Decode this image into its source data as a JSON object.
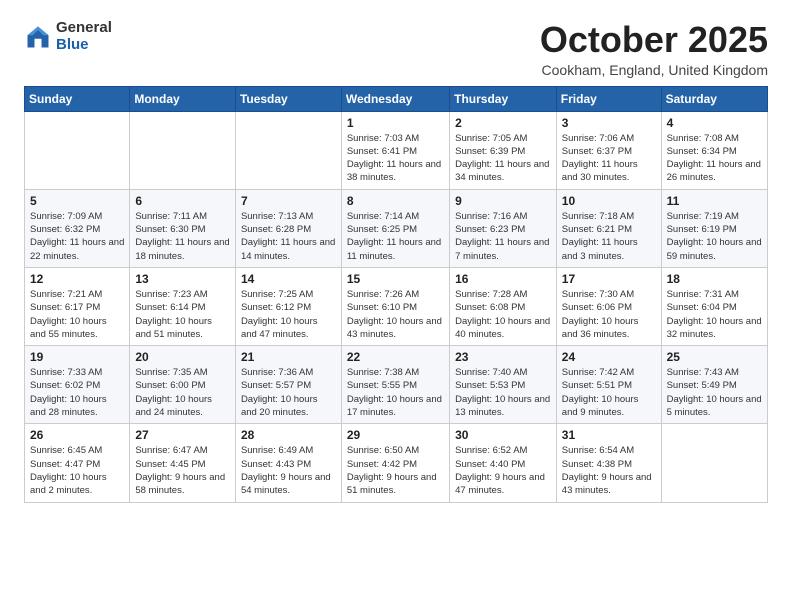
{
  "logo": {
    "general": "General",
    "blue": "Blue"
  },
  "title": "October 2025",
  "location": "Cookham, England, United Kingdom",
  "days_of_week": [
    "Sunday",
    "Monday",
    "Tuesday",
    "Wednesday",
    "Thursday",
    "Friday",
    "Saturday"
  ],
  "weeks": [
    [
      {
        "day": "",
        "info": ""
      },
      {
        "day": "",
        "info": ""
      },
      {
        "day": "",
        "info": ""
      },
      {
        "day": "1",
        "info": "Sunrise: 7:03 AM\nSunset: 6:41 PM\nDaylight: 11 hours\nand 38 minutes."
      },
      {
        "day": "2",
        "info": "Sunrise: 7:05 AM\nSunset: 6:39 PM\nDaylight: 11 hours\nand 34 minutes."
      },
      {
        "day": "3",
        "info": "Sunrise: 7:06 AM\nSunset: 6:37 PM\nDaylight: 11 hours\nand 30 minutes."
      },
      {
        "day": "4",
        "info": "Sunrise: 7:08 AM\nSunset: 6:34 PM\nDaylight: 11 hours\nand 26 minutes."
      }
    ],
    [
      {
        "day": "5",
        "info": "Sunrise: 7:09 AM\nSunset: 6:32 PM\nDaylight: 11 hours\nand 22 minutes."
      },
      {
        "day": "6",
        "info": "Sunrise: 7:11 AM\nSunset: 6:30 PM\nDaylight: 11 hours\nand 18 minutes."
      },
      {
        "day": "7",
        "info": "Sunrise: 7:13 AM\nSunset: 6:28 PM\nDaylight: 11 hours\nand 14 minutes."
      },
      {
        "day": "8",
        "info": "Sunrise: 7:14 AM\nSunset: 6:25 PM\nDaylight: 11 hours\nand 11 minutes."
      },
      {
        "day": "9",
        "info": "Sunrise: 7:16 AM\nSunset: 6:23 PM\nDaylight: 11 hours\nand 7 minutes."
      },
      {
        "day": "10",
        "info": "Sunrise: 7:18 AM\nSunset: 6:21 PM\nDaylight: 11 hours\nand 3 minutes."
      },
      {
        "day": "11",
        "info": "Sunrise: 7:19 AM\nSunset: 6:19 PM\nDaylight: 10 hours\nand 59 minutes."
      }
    ],
    [
      {
        "day": "12",
        "info": "Sunrise: 7:21 AM\nSunset: 6:17 PM\nDaylight: 10 hours\nand 55 minutes."
      },
      {
        "day": "13",
        "info": "Sunrise: 7:23 AM\nSunset: 6:14 PM\nDaylight: 10 hours\nand 51 minutes."
      },
      {
        "day": "14",
        "info": "Sunrise: 7:25 AM\nSunset: 6:12 PM\nDaylight: 10 hours\nand 47 minutes."
      },
      {
        "day": "15",
        "info": "Sunrise: 7:26 AM\nSunset: 6:10 PM\nDaylight: 10 hours\nand 43 minutes."
      },
      {
        "day": "16",
        "info": "Sunrise: 7:28 AM\nSunset: 6:08 PM\nDaylight: 10 hours\nand 40 minutes."
      },
      {
        "day": "17",
        "info": "Sunrise: 7:30 AM\nSunset: 6:06 PM\nDaylight: 10 hours\nand 36 minutes."
      },
      {
        "day": "18",
        "info": "Sunrise: 7:31 AM\nSunset: 6:04 PM\nDaylight: 10 hours\nand 32 minutes."
      }
    ],
    [
      {
        "day": "19",
        "info": "Sunrise: 7:33 AM\nSunset: 6:02 PM\nDaylight: 10 hours\nand 28 minutes."
      },
      {
        "day": "20",
        "info": "Sunrise: 7:35 AM\nSunset: 6:00 PM\nDaylight: 10 hours\nand 24 minutes."
      },
      {
        "day": "21",
        "info": "Sunrise: 7:36 AM\nSunset: 5:57 PM\nDaylight: 10 hours\nand 20 minutes."
      },
      {
        "day": "22",
        "info": "Sunrise: 7:38 AM\nSunset: 5:55 PM\nDaylight: 10 hours\nand 17 minutes."
      },
      {
        "day": "23",
        "info": "Sunrise: 7:40 AM\nSunset: 5:53 PM\nDaylight: 10 hours\nand 13 minutes."
      },
      {
        "day": "24",
        "info": "Sunrise: 7:42 AM\nSunset: 5:51 PM\nDaylight: 10 hours\nand 9 minutes."
      },
      {
        "day": "25",
        "info": "Sunrise: 7:43 AM\nSunset: 5:49 PM\nDaylight: 10 hours\nand 5 minutes."
      }
    ],
    [
      {
        "day": "26",
        "info": "Sunrise: 6:45 AM\nSunset: 4:47 PM\nDaylight: 10 hours\nand 2 minutes."
      },
      {
        "day": "27",
        "info": "Sunrise: 6:47 AM\nSunset: 4:45 PM\nDaylight: 9 hours\nand 58 minutes."
      },
      {
        "day": "28",
        "info": "Sunrise: 6:49 AM\nSunset: 4:43 PM\nDaylight: 9 hours\nand 54 minutes."
      },
      {
        "day": "29",
        "info": "Sunrise: 6:50 AM\nSunset: 4:42 PM\nDaylight: 9 hours\nand 51 minutes."
      },
      {
        "day": "30",
        "info": "Sunrise: 6:52 AM\nSunset: 4:40 PM\nDaylight: 9 hours\nand 47 minutes."
      },
      {
        "day": "31",
        "info": "Sunrise: 6:54 AM\nSunset: 4:38 PM\nDaylight: 9 hours\nand 43 minutes."
      },
      {
        "day": "",
        "info": ""
      }
    ]
  ]
}
